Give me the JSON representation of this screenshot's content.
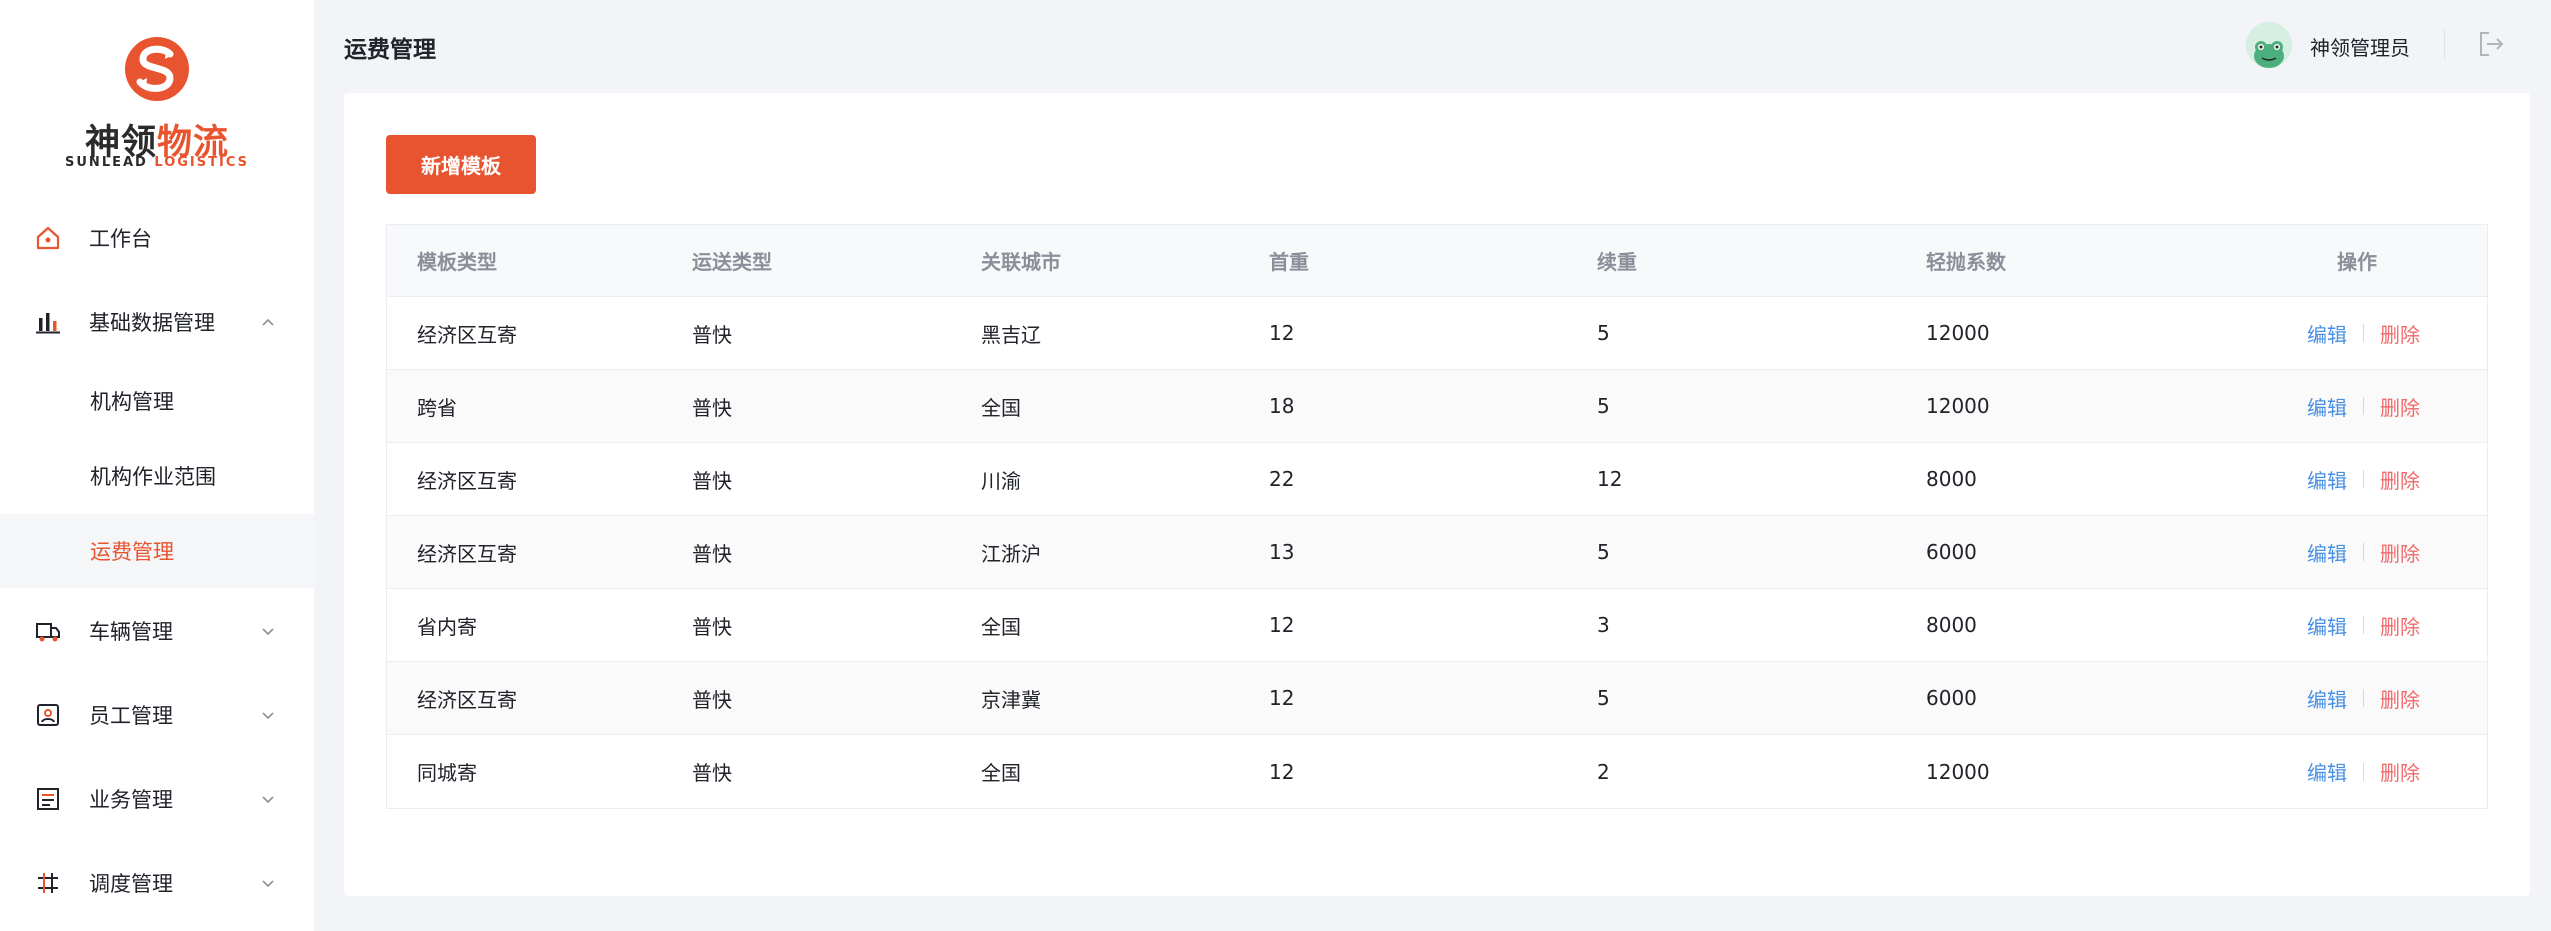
{
  "brand": {
    "name_part1": "神领",
    "name_part2": "物流",
    "sub_part1": "SUNLEAD",
    "sub_part2": "LOGISTICS",
    "accent_color": "#e8542f"
  },
  "sidebar": {
    "items": [
      {
        "label": "工作台",
        "icon": "home-icon"
      },
      {
        "label": "基础数据管理",
        "icon": "bar-chart-icon",
        "expanded": true,
        "children": [
          {
            "label": "机构管理"
          },
          {
            "label": "机构作业范围"
          },
          {
            "label": "运费管理",
            "active": true
          }
        ]
      },
      {
        "label": "车辆管理",
        "icon": "truck-icon"
      },
      {
        "label": "员工管理",
        "icon": "id-card-icon"
      },
      {
        "label": "业务管理",
        "icon": "document-icon"
      },
      {
        "label": "调度管理",
        "icon": "dispatch-icon"
      }
    ]
  },
  "header": {
    "title": "运费管理",
    "user_name": "神领管理员"
  },
  "main": {
    "add_button": "新增模板",
    "columns": [
      "模板类型",
      "运送类型",
      "关联城市",
      "首重",
      "续重",
      "轻抛系数",
      "操作"
    ],
    "rows": [
      [
        "经济区互寄",
        "普快",
        "黑吉辽",
        "12",
        "5",
        "12000"
      ],
      [
        "跨省",
        "普快",
        "全国",
        "18",
        "5",
        "12000"
      ],
      [
        "经济区互寄",
        "普快",
        "川渝",
        "22",
        "12",
        "8000"
      ],
      [
        "经济区互寄",
        "普快",
        "江浙沪",
        "13",
        "5",
        "6000"
      ],
      [
        "省内寄",
        "普快",
        "全国",
        "12",
        "3",
        "8000"
      ],
      [
        "经济区互寄",
        "普快",
        "京津冀",
        "12",
        "5",
        "6000"
      ],
      [
        "同城寄",
        "普快",
        "全国",
        "12",
        "2",
        "12000"
      ]
    ],
    "edit_label": "编辑",
    "delete_label": "删除"
  }
}
